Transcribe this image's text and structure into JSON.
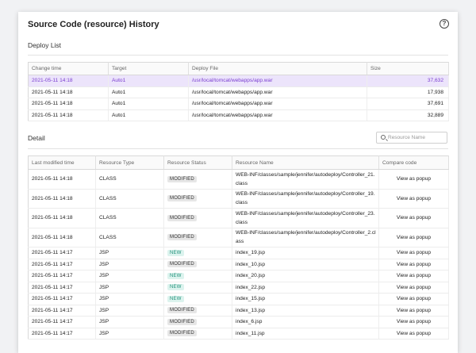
{
  "title": "Source Code (resource) History",
  "help_icon": "?",
  "deploy": {
    "section_label": "Deploy List",
    "columns": [
      "Change time",
      "Target",
      "Deploy File",
      "Size"
    ],
    "rows": [
      {
        "time": "2021-05-11 14:18",
        "target": "Auto1",
        "file": "/usr/local/tomcat/webapps/app.war",
        "size": "37,632"
      },
      {
        "time": "2021-05-11 14:18",
        "target": "Auto1",
        "file": "/usr/local/tomcat/webapps/app.war",
        "size": "17,938"
      },
      {
        "time": "2021-05-11 14:18",
        "target": "Auto1",
        "file": "/usr/local/tomcat/webapps/app.war",
        "size": "37,691"
      },
      {
        "time": "2021-05-11 14:18",
        "target": "Auto1",
        "file": "/usr/local/tomcat/webapps/app.war",
        "size": "32,889"
      }
    ]
  },
  "detail": {
    "section_label": "Detail",
    "search_placeholder": "Resource Name",
    "columns": [
      "Last modified time",
      "Resource Type",
      "Resource Status",
      "Resource Name",
      "Compare code"
    ],
    "rows": [
      {
        "time": "2021-05-11 14:18",
        "type": "CLASS",
        "status": "MODIFIED",
        "name": "WEB-INF/classes/sample/jennifer/autodeploy/Controller_21.class",
        "compare": "View as popup"
      },
      {
        "time": "2021-05-11 14:18",
        "type": "CLASS",
        "status": "MODIFIED",
        "name": "WEB-INF/classes/sample/jennifer/autodeploy/Controller_19.class",
        "compare": "View as popup"
      },
      {
        "time": "2021-05-11 14:18",
        "type": "CLASS",
        "status": "MODIFIED",
        "name": "WEB-INF/classes/sample/jennifer/autodeploy/Controller_23.class",
        "compare": "View as popup"
      },
      {
        "time": "2021-05-11 14:18",
        "type": "CLASS",
        "status": "MODIFIED",
        "name": "WEB-INF/classes/sample/jennifer/autodeploy/Controller_2.class",
        "compare": "View as popup"
      },
      {
        "time": "2021-05-11 14:17",
        "type": "JSP",
        "status": "NEW",
        "name": "index_19.jsp",
        "compare": "View as popup"
      },
      {
        "time": "2021-05-11 14:17",
        "type": "JSP",
        "status": "MODIFIED",
        "name": "index_10.jsp",
        "compare": "View as popup"
      },
      {
        "time": "2021-05-11 14:17",
        "type": "JSP",
        "status": "NEW",
        "name": "index_20.jsp",
        "compare": "View as popup"
      },
      {
        "time": "2021-05-11 14:17",
        "type": "JSP",
        "status": "NEW",
        "name": "index_22.jsp",
        "compare": "View as popup"
      },
      {
        "time": "2021-05-11 14:17",
        "type": "JSP",
        "status": "NEW",
        "name": "index_15.jsp",
        "compare": "View as popup"
      },
      {
        "time": "2021-05-11 14:17",
        "type": "JSP",
        "status": "MODIFIED",
        "name": "index_13.jsp",
        "compare": "View as popup"
      },
      {
        "time": "2021-05-11 14:17",
        "type": "JSP",
        "status": "MODIFIED",
        "name": "index_6.jsp",
        "compare": "View as popup"
      },
      {
        "time": "2021-05-11 14:17",
        "type": "JSP",
        "status": "MODIFIED",
        "name": "index_11.jsp",
        "compare": "View as popup"
      }
    ]
  },
  "colors": {
    "selected_row_bg": "#ece4fb",
    "selected_row_text": "#7b3fd1",
    "modified_badge_bg": "#e6e6e6",
    "new_badge_bg": "#dcf3ee",
    "new_badge_text": "#1d8f78"
  }
}
